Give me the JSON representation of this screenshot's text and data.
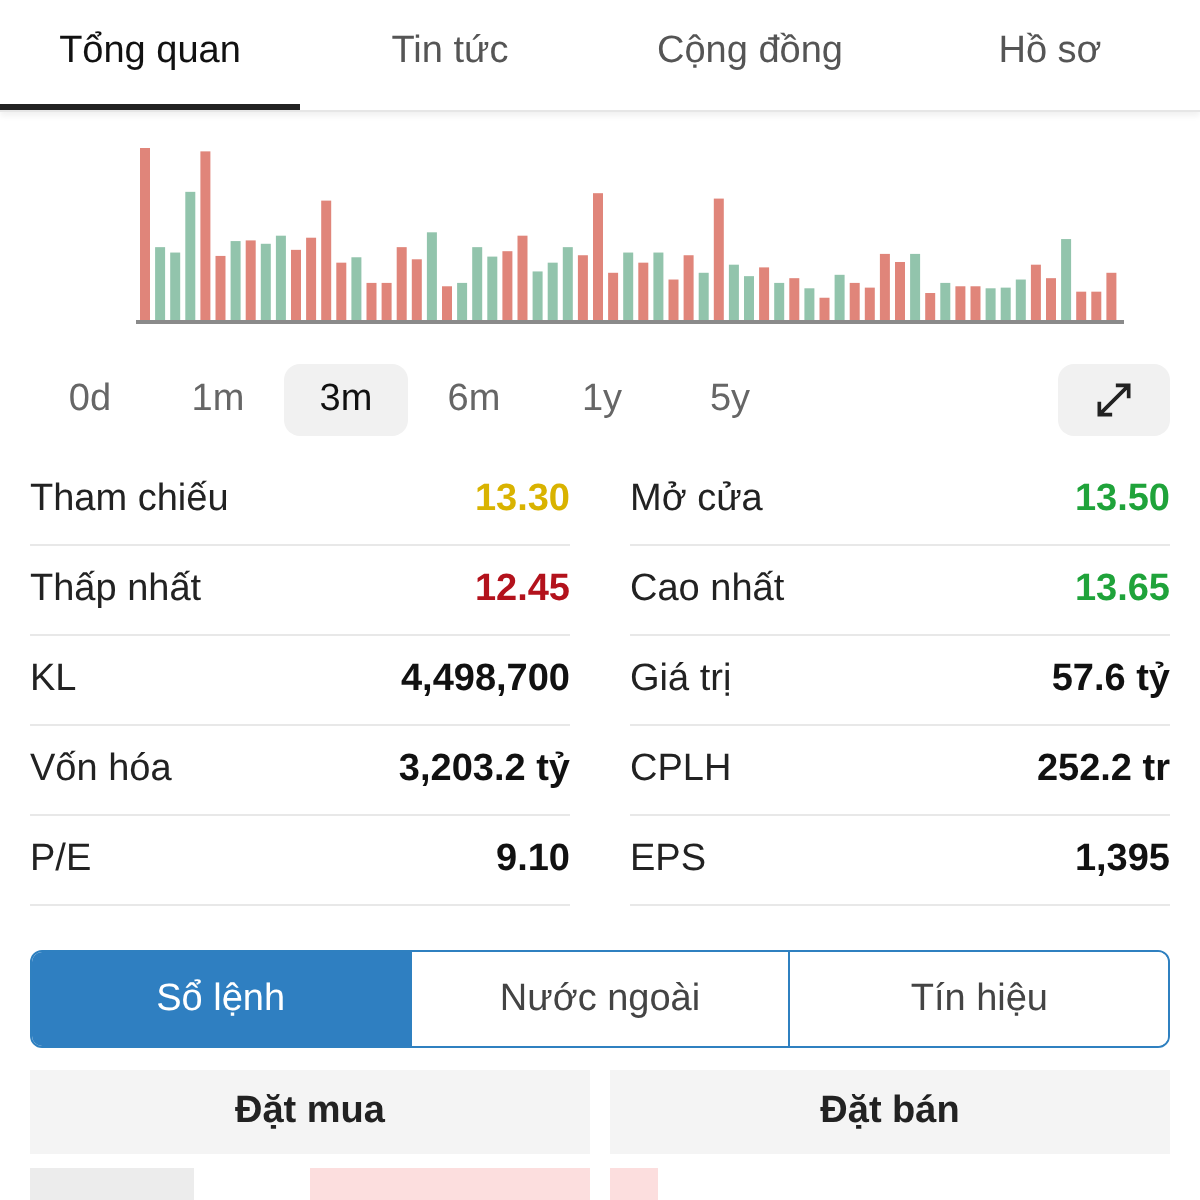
{
  "tabs": [
    {
      "label": "Tổng quan",
      "selected": true
    },
    {
      "label": "Tin tức",
      "selected": false
    },
    {
      "label": "Cộng đồng",
      "selected": false
    },
    {
      "label": "Hồ sơ",
      "selected": false
    }
  ],
  "ranges": [
    {
      "label": "0d",
      "selected": false
    },
    {
      "label": "1m",
      "selected": false
    },
    {
      "label": "3m",
      "selected": true
    },
    {
      "label": "6m",
      "selected": false
    },
    {
      "label": "1y",
      "selected": false
    },
    {
      "label": "5y",
      "selected": false
    }
  ],
  "stats": [
    {
      "label": "Tham chiếu",
      "value": "13.30",
      "color": "#d9b300"
    },
    {
      "label": "Mở cửa",
      "value": "13.50",
      "color": "#1fa33a"
    },
    {
      "label": "Thấp nhất",
      "value": "12.45",
      "color": "#b3121c"
    },
    {
      "label": "Cao nhất",
      "value": "13.65",
      "color": "#1fa33a"
    },
    {
      "label": "KL",
      "value": "4,498,700",
      "color": "#111111"
    },
    {
      "label": "Giá trị",
      "value": "57.6 tỷ",
      "color": "#111111"
    },
    {
      "label": "Vốn hóa",
      "value": "3,203.2 tỷ",
      "color": "#111111"
    },
    {
      "label": "CPLH",
      "value": "252.2 tr",
      "color": "#111111"
    },
    {
      "label": "P/E",
      "value": "9.10",
      "color": "#111111"
    },
    {
      "label": "EPS",
      "value": "1,395",
      "color": "#111111"
    }
  ],
  "segments": [
    {
      "label": "Sổ lệnh",
      "selected": true
    },
    {
      "label": "Nước ngoài",
      "selected": false
    },
    {
      "label": "Tín hiệu",
      "selected": false
    }
  ],
  "order_book": {
    "headers": [
      "Đặt mua",
      "Đặt bán"
    ]
  }
}
